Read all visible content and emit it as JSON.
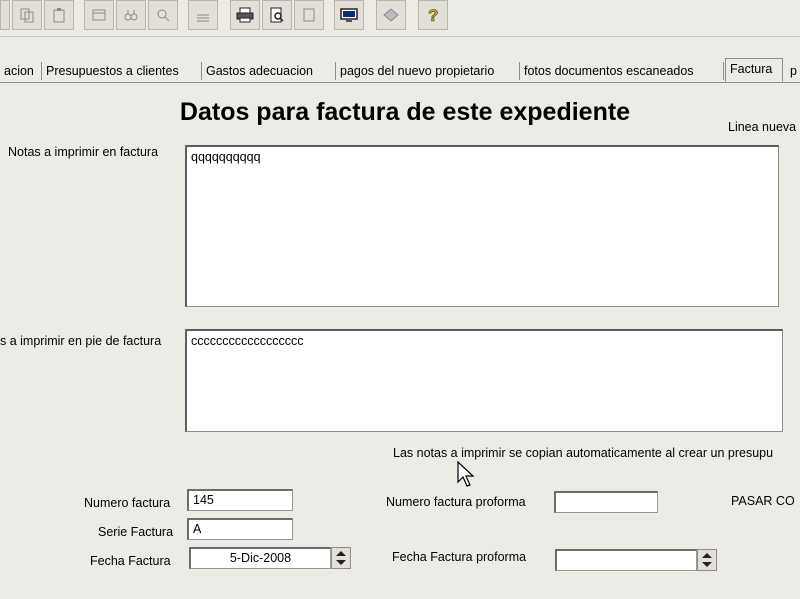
{
  "toolbar": {
    "icons": [
      "copy-icon",
      "paste-icon",
      "window-icon",
      "binoculars-icon",
      "search-icon",
      "document-icon",
      "printer-icon",
      "print-preview-icon",
      "blank-page-icon",
      "monitor-icon",
      "eraser-icon",
      "help-icon"
    ]
  },
  "tabs": [
    "acion",
    "Presupuestos a clientes",
    "Gastos adecuacion",
    "pagos del nuevo propietario",
    "fotos documentos escaneados",
    "Factura",
    "p"
  ],
  "active_tab": "Factura",
  "page_title": "Datos para factura de este expediente",
  "linea_nueva_label": "Linea nueva",
  "notes": {
    "label": "Notas a imprimir en factura",
    "value": "qqqqqqqqqq"
  },
  "footer_notes": {
    "label": "s a imprimir en pie de factura",
    "value": "cccccccccccccccccc"
  },
  "info_text": "Las notas a imprimir se copian automaticamente al crear un presupu",
  "numero_factura": {
    "label": "Numero factura",
    "value": "145"
  },
  "serie_factura": {
    "label": "Serie Factura",
    "value": "A"
  },
  "fecha_factura": {
    "label": "Fecha Factura",
    "value": "5-Dic-2008"
  },
  "numero_proforma": {
    "label": "Numero factura proforma",
    "value": ""
  },
  "fecha_proforma": {
    "label": "Fecha Factura proforma",
    "value": ""
  },
  "pasar_label": "PASAR CO"
}
